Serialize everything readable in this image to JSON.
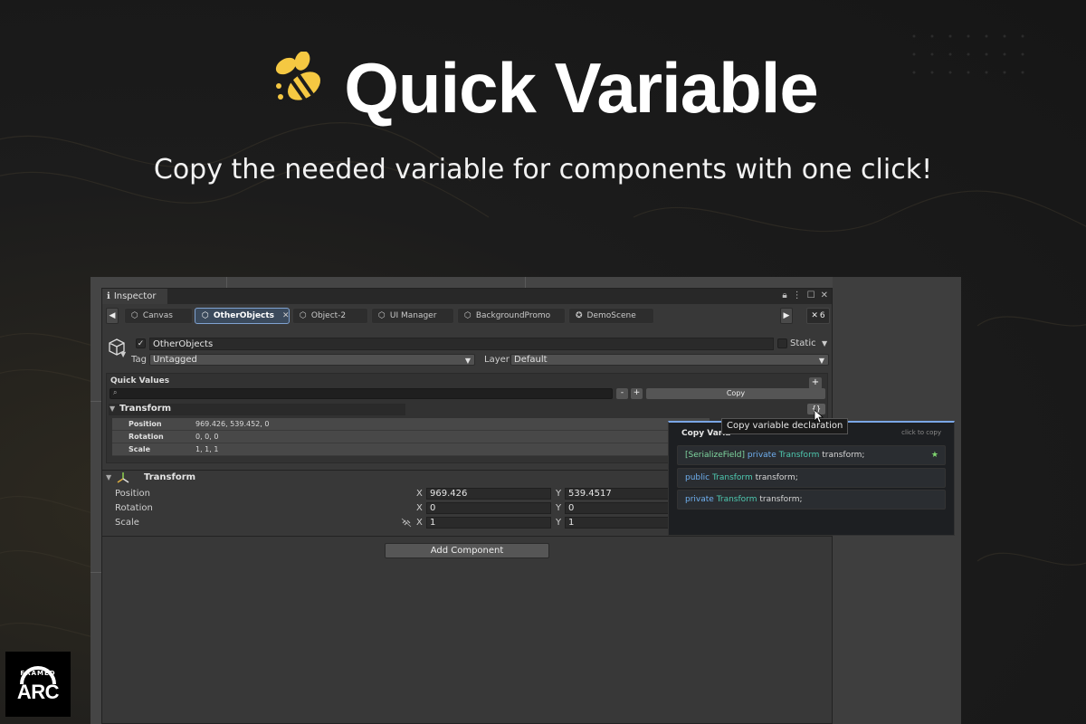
{
  "hero": {
    "title": "Quick Variable",
    "subtitle": "Copy the needed variable for components with one click!"
  },
  "colors": {
    "accent": "#f5c842",
    "popup_border": "#7aa6e6",
    "attribute": "#7fd6a0",
    "keyword": "#6fb0f0",
    "type": "#4ec9b0"
  },
  "inspector": {
    "tab_label": "Inspector",
    "object_tabs": [
      "Canvas",
      "OtherObjects",
      "Object-2",
      "UI Manager",
      "BackgroundPromo",
      "DemoScene"
    ],
    "tab_count": "6",
    "object_name": "OtherObjects",
    "static_label": "Static",
    "tag_label": "Tag",
    "tag_value": "Untagged",
    "layer_label": "Layer",
    "layer_value": "Default"
  },
  "quick_values": {
    "title": "Quick Values",
    "plus": "+",
    "minus_btn": "-",
    "plus_btn": "+",
    "copy_label": "Copy",
    "component": "Transform",
    "context_btn": "{}",
    "rows": [
      {
        "key": "Position",
        "value": "969.426, 539.452, 0"
      },
      {
        "key": "Rotation",
        "value": "0, 0, 0"
      },
      {
        "key": "Scale",
        "value": "1, 1, 1"
      }
    ]
  },
  "transform": {
    "title": "Transform",
    "rows": [
      {
        "label": "Position",
        "x_label": "X",
        "x": "969.426",
        "y_label": "Y",
        "y": "539.4517"
      },
      {
        "label": "Rotation",
        "x_label": "X",
        "x": "0",
        "y_label": "Y",
        "y": "0"
      },
      {
        "label": "Scale",
        "x_label": "X",
        "x": "1",
        "y_label": "Y",
        "y": "1"
      }
    ],
    "add_component": "Add Component"
  },
  "popup": {
    "title": "Copy Varia",
    "hint": "click to copy",
    "tooltip": "Copy variable declaration",
    "options": [
      {
        "attr": "[SerializeField]",
        "kw": "private",
        "type": "Transform",
        "name": "transform;",
        "star": "★"
      },
      {
        "kw": "public",
        "type": "Transform",
        "name": "transform;"
      },
      {
        "kw": "private",
        "type": "Transform",
        "name": "transform;"
      }
    ]
  },
  "badge": {
    "top": "FRAMED",
    "brand": "ARC"
  }
}
